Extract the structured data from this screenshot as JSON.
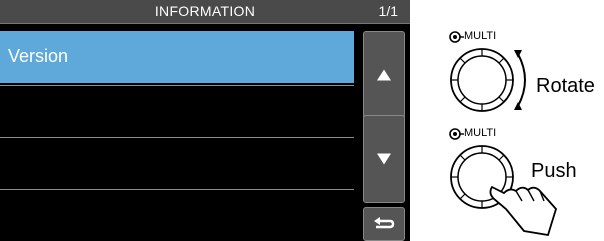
{
  "header": {
    "title": "INFORMATION",
    "page_indicator": "1/1"
  },
  "menu": {
    "items": [
      {
        "label": "Version",
        "selected": true
      },
      {
        "label": ""
      },
      {
        "label": ""
      },
      {
        "label": ""
      }
    ]
  },
  "controls": {
    "up_icon": "triangle-up-icon",
    "down_icon": "triangle-down-icon",
    "back_icon": "return-arrow-icon"
  },
  "annotations": {
    "rotate": {
      "dial_label": "MULTI",
      "action": "Rotate"
    },
    "push": {
      "dial_label": "MULTI",
      "action": "Push"
    }
  },
  "colors": {
    "selected_row": "#5ea9d9",
    "screen_bg": "#000000",
    "titlebar": "#4a4a4a",
    "button": "#555555"
  }
}
